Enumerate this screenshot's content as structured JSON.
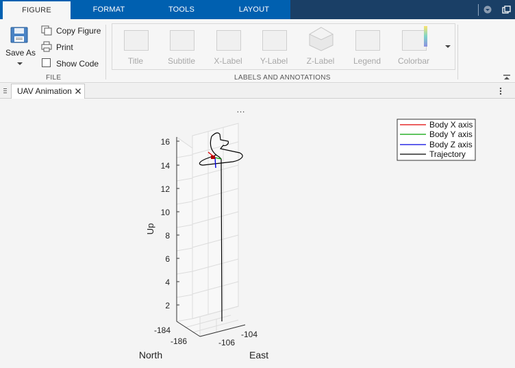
{
  "tabs": [
    {
      "label": "FIGURE",
      "active": true
    },
    {
      "label": "FORMAT",
      "active": false
    },
    {
      "label": "TOOLS",
      "active": false
    },
    {
      "label": "LAYOUT",
      "active": false
    }
  ],
  "file_group": {
    "title": "FILE",
    "save_as": "Save As",
    "copy_figure": "Copy Figure",
    "print": "Print",
    "show_code": "Show Code"
  },
  "annotations_group": {
    "title": "LABELS AND ANNOTATIONS",
    "buttons": [
      "Title",
      "Subtitle",
      "X-Label",
      "Y-Label",
      "Z-Label",
      "Legend",
      "Colorbar"
    ]
  },
  "document_tab": {
    "label": "UAV Animation"
  },
  "plot": {
    "axes_menu": "…",
    "zlabel": "Up",
    "xlabel": "North",
    "ylabel": "East",
    "z_ticks": [
      "16",
      "14",
      "12",
      "10",
      "8",
      "6",
      "4",
      "2"
    ],
    "north_ticks": [
      "-184",
      "-186"
    ],
    "east_ticks": [
      "-106",
      "-104"
    ],
    "legend": [
      {
        "label": "Body X axis",
        "color": "#e00000"
      },
      {
        "label": "Body Y axis",
        "color": "#00a000"
      },
      {
        "label": "Body Z axis",
        "color": "#0000e0"
      },
      {
        "label": "Trajectory",
        "color": "#000000"
      }
    ]
  },
  "colors": {
    "accent": "#0060b0",
    "tab_dark": "#1a3f66"
  }
}
